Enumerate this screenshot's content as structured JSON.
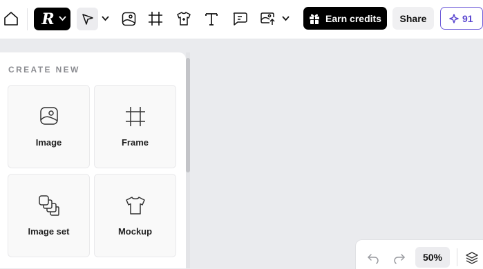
{
  "toolbar": {
    "logo_letter": "R",
    "earn_credits_label": "Earn credits",
    "share_label": "Share",
    "credits_count": "91"
  },
  "panel": {
    "heading": "CREATE NEW",
    "cards": [
      {
        "label": "Image",
        "icon": "image-icon"
      },
      {
        "label": "Frame",
        "icon": "frame-icon"
      },
      {
        "label": "Image set",
        "icon": "image-set-icon"
      },
      {
        "label": "Mockup",
        "icon": "tshirt-icon"
      }
    ]
  },
  "zoom": {
    "value": "50%"
  },
  "colors": {
    "accent": "#6d5bd8",
    "dark_button": "#000000",
    "canvas": "#eaebee"
  }
}
